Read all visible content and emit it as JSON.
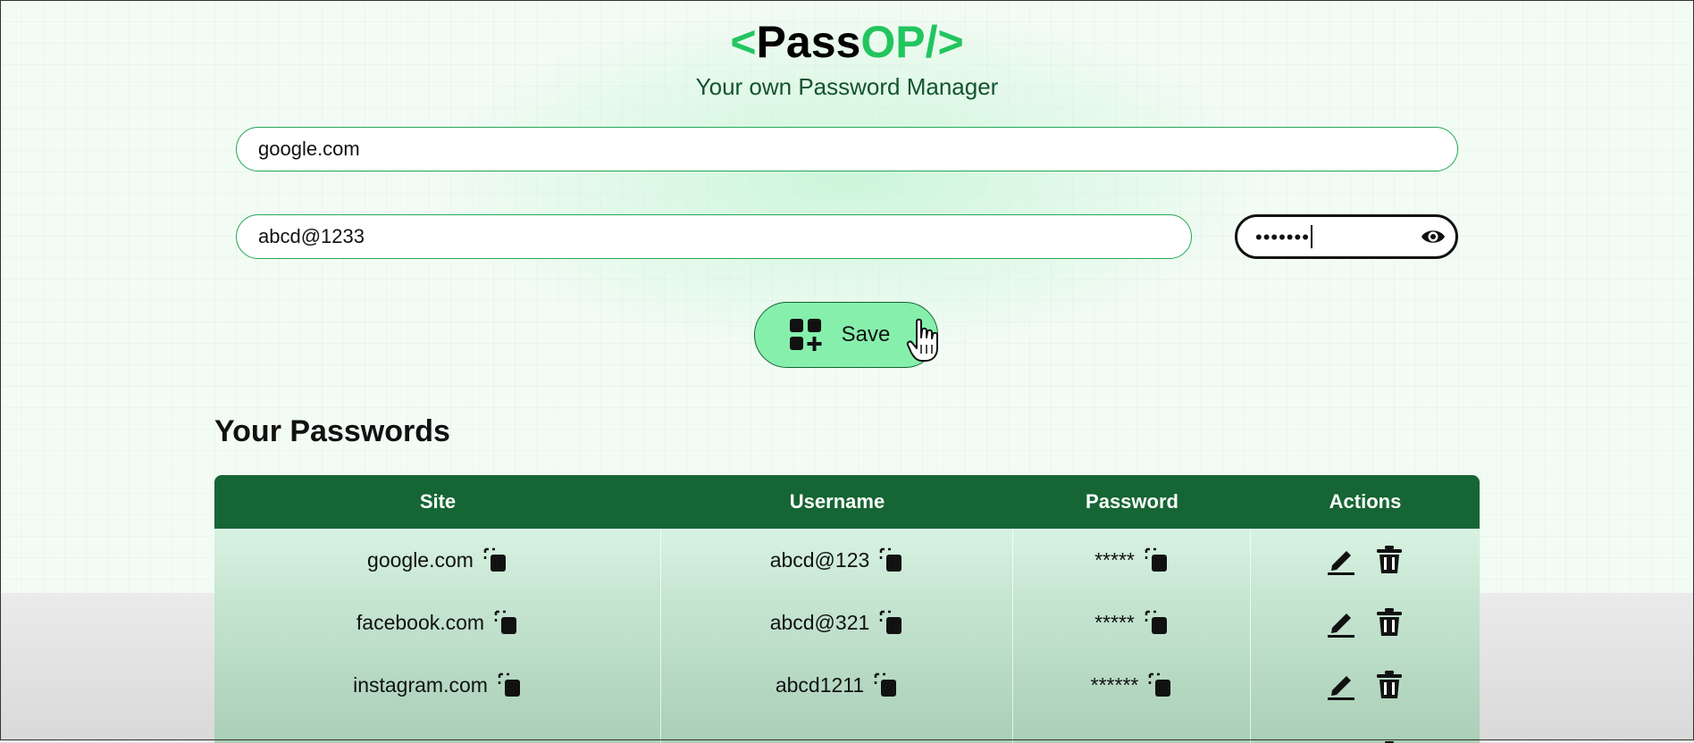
{
  "app": {
    "logo_open": "<",
    "logo_pass": "Pass",
    "logo_op": "OP",
    "logo_close": "/>",
    "tagline": "Your own Password Manager",
    "accent_color": "#22c55e",
    "header_color": "#166534"
  },
  "form": {
    "site_value": "google.com",
    "username_value": "abcd@1233",
    "password_masked": "•••••••",
    "show_password_icon": "eye-icon",
    "save_label": "Save",
    "save_icon": "add-grid-icon"
  },
  "passwords": {
    "title": "Your Passwords",
    "columns": [
      "Site",
      "Username",
      "Password",
      "Actions"
    ],
    "rows": [
      {
        "site": "google.com",
        "username": "abcd@123",
        "password": "*****"
      },
      {
        "site": "facebook.com",
        "username": "abcd@321",
        "password": "*****"
      },
      {
        "site": "instagram.com",
        "username": "abcd1211",
        "password": "******"
      }
    ],
    "copy_icon": "copy-icon",
    "edit_icon": "pencil-icon",
    "delete_icon": "trash-icon"
  }
}
